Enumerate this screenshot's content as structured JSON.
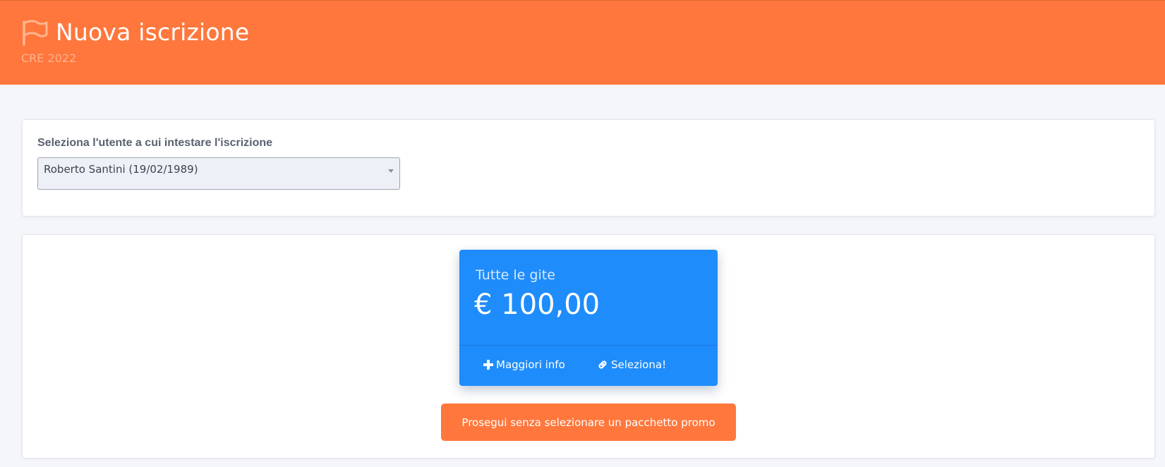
{
  "header": {
    "icon": "flag-icon",
    "title": "Nuova iscrizione",
    "subtitle": "CRE 2022",
    "color": "#ff773c"
  },
  "user_selection": {
    "label": "Seleziona l'utente a cui intestare l'iscrizione",
    "selected_value": "Roberto Santini (19/02/1989)"
  },
  "promo_packages": [
    {
      "name": "Tutte le gite",
      "price": "€ 100,00",
      "more_info_label": "Maggiori info",
      "more_info_icon": "plus-icon",
      "select_label": "Seleziona!",
      "select_icon": "link-icon",
      "color": "#1f8cfb"
    }
  ],
  "skip_button": {
    "label": "Prosegui senza selezionare un pacchetto promo",
    "color": "#ff773c"
  }
}
